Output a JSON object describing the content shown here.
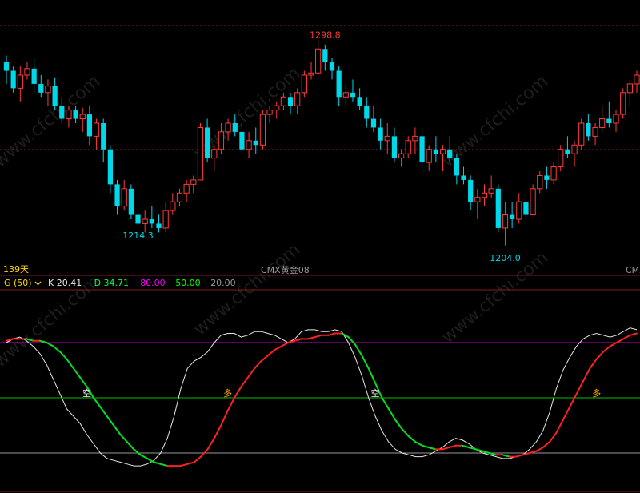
{
  "chart_data": [
    {
      "type": "candlestick",
      "ylim": [
        1196,
        1306
      ],
      "annotations": [
        {
          "text": "1298.8",
          "value": 1298.8,
          "color": "#ff3b3b"
        },
        {
          "text": "1214.3",
          "value": 1214.3,
          "color": "#00d7e8"
        },
        {
          "text": "1204.0",
          "value": 1204.0,
          "color": "#00d7e8"
        }
      ],
      "period_label": "139天",
      "instrument_label": "CMX黄金08",
      "instrument_label_short": "CMX",
      "up_color": "#ff3b3b",
      "down_color": "#00d7e8",
      "candles": [
        [
          1290,
          1293,
          1280,
          1286
        ],
        [
          1286,
          1288,
          1276,
          1278
        ],
        [
          1278,
          1288,
          1272,
          1284
        ],
        [
          1284,
          1290,
          1282,
          1287
        ],
        [
          1287,
          1292,
          1276,
          1280
        ],
        [
          1280,
          1284,
          1274,
          1276
        ],
        [
          1276,
          1282,
          1270,
          1279
        ],
        [
          1279,
          1283,
          1268,
          1270
        ],
        [
          1270,
          1274,
          1262,
          1264
        ],
        [
          1264,
          1270,
          1260,
          1268
        ],
        [
          1268,
          1270,
          1262,
          1264
        ],
        [
          1264,
          1269,
          1258,
          1266
        ],
        [
          1266,
          1270,
          1252,
          1256
        ],
        [
          1256,
          1264,
          1250,
          1262
        ],
        [
          1262,
          1264,
          1244,
          1250
        ],
        [
          1250,
          1252,
          1230,
          1234
        ],
        [
          1234,
          1236,
          1220,
          1224
        ],
        [
          1224,
          1236,
          1222,
          1232
        ],
        [
          1232,
          1234,
          1218,
          1220
        ],
        [
          1220,
          1224,
          1214,
          1216
        ],
        [
          1216,
          1222,
          1212,
          1218
        ],
        [
          1218,
          1224,
          1214,
          1216
        ],
        [
          1216,
          1220,
          1212,
          1214
        ],
        [
          1214,
          1226,
          1212,
          1222
        ],
        [
          1222,
          1230,
          1220,
          1226
        ],
        [
          1226,
          1232,
          1224,
          1230
        ],
        [
          1230,
          1236,
          1226,
          1234
        ],
        [
          1234,
          1238,
          1230,
          1236
        ],
        [
          1236,
          1262,
          1236,
          1260
        ],
        [
          1260,
          1264,
          1244,
          1246
        ],
        [
          1246,
          1252,
          1240,
          1250
        ],
        [
          1250,
          1262,
          1248,
          1258
        ],
        [
          1258,
          1264,
          1254,
          1262
        ],
        [
          1262,
          1266,
          1256,
          1258
        ],
        [
          1258,
          1262,
          1248,
          1250
        ],
        [
          1250,
          1258,
          1246,
          1254
        ],
        [
          1254,
          1260,
          1248,
          1252
        ],
        [
          1252,
          1268,
          1250,
          1266
        ],
        [
          1266,
          1270,
          1262,
          1268
        ],
        [
          1268,
          1272,
          1264,
          1270
        ],
        [
          1270,
          1276,
          1268,
          1274
        ],
        [
          1274,
          1276,
          1266,
          1270
        ],
        [
          1270,
          1278,
          1266,
          1276
        ],
        [
          1276,
          1286,
          1274,
          1284
        ],
        [
          1284,
          1290,
          1282,
          1285
        ],
        [
          1285,
          1300,
          1284,
          1296
        ],
        [
          1296,
          1298,
          1286,
          1290
        ],
        [
          1290,
          1292,
          1282,
          1286
        ],
        [
          1286,
          1288,
          1270,
          1274
        ],
        [
          1274,
          1280,
          1270,
          1276
        ],
        [
          1276,
          1282,
          1272,
          1274
        ],
        [
          1274,
          1278,
          1268,
          1270
        ],
        [
          1270,
          1274,
          1260,
          1264
        ],
        [
          1264,
          1270,
          1258,
          1260
        ],
        [
          1260,
          1264,
          1250,
          1254
        ],
        [
          1254,
          1262,
          1248,
          1256
        ],
        [
          1256,
          1260,
          1244,
          1246
        ],
        [
          1246,
          1250,
          1242,
          1248
        ],
        [
          1248,
          1256,
          1246,
          1254
        ],
        [
          1254,
          1260,
          1248,
          1256
        ],
        [
          1256,
          1260,
          1238,
          1244
        ],
        [
          1244,
          1252,
          1240,
          1250
        ],
        [
          1250,
          1256,
          1244,
          1248
        ],
        [
          1248,
          1252,
          1240,
          1250
        ],
        [
          1250,
          1256,
          1244,
          1246
        ],
        [
          1246,
          1248,
          1234,
          1238
        ],
        [
          1238,
          1242,
          1234,
          1236
        ],
        [
          1236,
          1238,
          1222,
          1226
        ],
        [
          1226,
          1232,
          1218,
          1228
        ],
        [
          1228,
          1234,
          1224,
          1230
        ],
        [
          1230,
          1238,
          1228,
          1232
        ],
        [
          1232,
          1234,
          1212,
          1214
        ],
        [
          1214,
          1226,
          1206,
          1220
        ],
        [
          1220,
          1226,
          1214,
          1218
        ],
        [
          1218,
          1230,
          1216,
          1226
        ],
        [
          1226,
          1232,
          1216,
          1220
        ],
        [
          1220,
          1234,
          1220,
          1232
        ],
        [
          1232,
          1240,
          1230,
          1238
        ],
        [
          1238,
          1242,
          1232,
          1236
        ],
        [
          1236,
          1244,
          1234,
          1242
        ],
        [
          1242,
          1252,
          1240,
          1250
        ],
        [
          1250,
          1256,
          1246,
          1248
        ],
        [
          1248,
          1254,
          1242,
          1252
        ],
        [
          1252,
          1264,
          1250,
          1262
        ],
        [
          1262,
          1266,
          1254,
          1256
        ],
        [
          1256,
          1262,
          1252,
          1260
        ],
        [
          1260,
          1270,
          1258,
          1264
        ],
        [
          1264,
          1272,
          1260,
          1262
        ],
        [
          1262,
          1268,
          1258,
          1266
        ],
        [
          1266,
          1278,
          1264,
          1276
        ],
        [
          1276,
          1282,
          1270,
          1280
        ],
        [
          1280,
          1286,
          1276,
          1284
        ]
      ]
    },
    {
      "type": "line",
      "indicator_label": "G (50)",
      "ylim": [
        0,
        100
      ],
      "readouts": [
        {
          "label": "K",
          "value": "20.41",
          "color": "#e8e8e8"
        },
        {
          "label": "D",
          "value": "34.71",
          "color": "#00ff3a"
        },
        {
          "label": "",
          "value": "80.00",
          "color": "#ff00ff"
        },
        {
          "label": "",
          "value": "50.00",
          "color": "#00ff00"
        },
        {
          "label": "",
          "value": "20.00",
          "color": "#9a9a9a"
        }
      ],
      "reference_lines": [
        {
          "value": 80,
          "color": "#c000c0"
        },
        {
          "value": 50,
          "color": "#00c000"
        },
        {
          "value": 20,
          "color": "#9a9a9a"
        }
      ],
      "signals": [
        {
          "text": "空",
          "index": 12,
          "value": 50,
          "color": "#e8e8e8"
        },
        {
          "text": "多",
          "index": 33,
          "value": 50,
          "color": "#ffa500"
        },
        {
          "text": "空",
          "index": 55,
          "value": 50,
          "color": "#e8e8e8"
        },
        {
          "text": "多",
          "index": 88,
          "value": 50,
          "color": "#ffa500"
        }
      ],
      "series": [
        {
          "color_up": "#ff2020",
          "color_down": "#00e020",
          "values": [
            81,
            82,
            82,
            82,
            81,
            81,
            80,
            78,
            75,
            71,
            66,
            61,
            56,
            50,
            45,
            40,
            35,
            30,
            26,
            22,
            19,
            17,
            15,
            14,
            13,
            13,
            13,
            14,
            15,
            18,
            22,
            28,
            35,
            43,
            50,
            56,
            61,
            66,
            70,
            73,
            76,
            78,
            80,
            81,
            82,
            82,
            83,
            84,
            84,
            85,
            85,
            83,
            79,
            73,
            66,
            58,
            50,
            44,
            38,
            33,
            29,
            26,
            24,
            23,
            22,
            22,
            23,
            24,
            24,
            23,
            22,
            21,
            20,
            19,
            19,
            18,
            18,
            19,
            20,
            21,
            23,
            26,
            31,
            38,
            45,
            52,
            59,
            66,
            71,
            75,
            78,
            80,
            82,
            84,
            85
          ]
        },
        {
          "color": "#e8e8e8",
          "values": [
            80,
            82,
            83,
            81,
            78,
            74,
            68,
            60,
            52,
            44,
            40,
            36,
            30,
            25,
            20,
            17,
            16,
            15,
            14,
            13,
            13,
            14,
            16,
            20,
            28,
            40,
            55,
            66,
            70,
            72,
            75,
            80,
            84,
            85,
            85,
            83,
            84,
            86,
            86,
            85,
            84,
            82,
            80,
            82,
            86,
            87,
            87,
            86,
            86,
            87,
            86,
            80,
            72,
            62,
            50,
            40,
            32,
            26,
            22,
            20,
            19,
            18,
            18,
            19,
            21,
            23,
            26,
            28,
            27,
            25,
            22,
            20,
            19,
            18,
            17,
            17,
            18,
            19,
            22,
            26,
            32,
            42,
            55,
            65,
            72,
            78,
            82,
            84,
            85,
            84,
            83,
            84,
            86,
            88,
            87
          ]
        }
      ]
    }
  ]
}
